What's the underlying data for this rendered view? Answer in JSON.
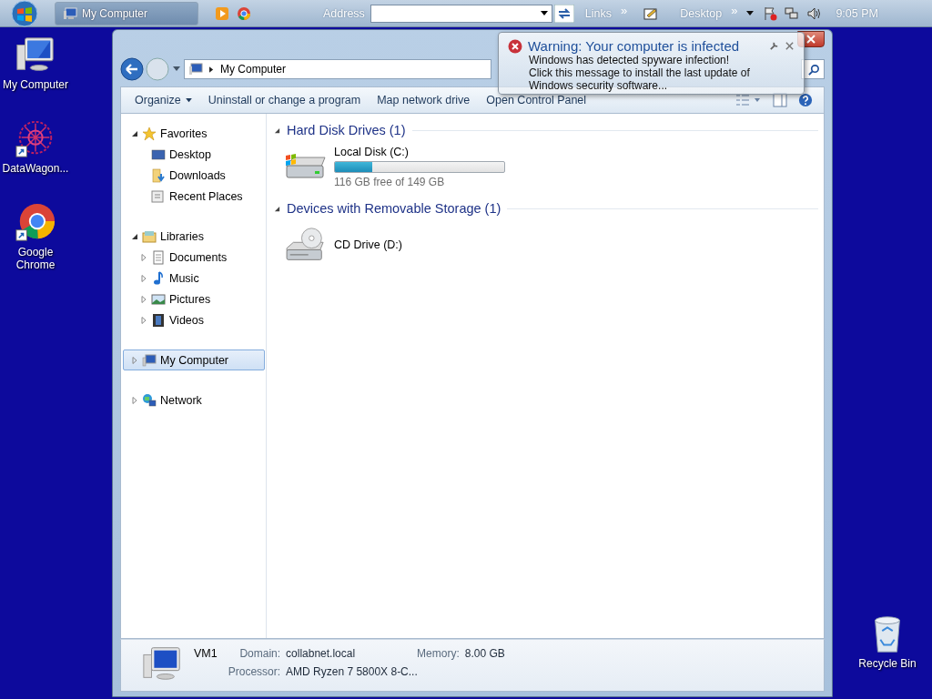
{
  "taskbar": {
    "task": {
      "label": "My Computer",
      "selected": true
    },
    "address_label": "Address",
    "links_label": "Links",
    "links_more": "»",
    "desktop_label": "Desktop",
    "desktop_more": "»",
    "clock": "9:05 PM"
  },
  "desktop_icons": [
    {
      "label": "My Computer",
      "kind": "computer"
    },
    {
      "label": "DataWagon...",
      "kind": "datawagon"
    },
    {
      "label": "Google Chrome",
      "kind": "chrome"
    }
  ],
  "recycle_bin": {
    "label": "Recycle Bin"
  },
  "window": {
    "breadcrumb": "My Computer",
    "toolbar": [
      {
        "label": "Organize",
        "kind": "menu"
      },
      {
        "label": "Uninstall or change a program",
        "kind": "command"
      },
      {
        "label": "Map network drive",
        "kind": "command"
      },
      {
        "label": "Open Control Panel",
        "kind": "command"
      }
    ],
    "nav": [
      {
        "label": "Favorites",
        "kind": "star",
        "expanded": true,
        "selected": false,
        "children": [
          {
            "label": "Desktop",
            "kind": "desktop",
            "selected": false
          },
          {
            "label": "Downloads",
            "kind": "downloads",
            "selected": false
          },
          {
            "label": "Recent Places",
            "kind": "recent",
            "selected": false
          }
        ]
      },
      {
        "label": "Libraries",
        "kind": "libraries",
        "expanded": true,
        "selected": false,
        "children": [
          {
            "label": "Documents",
            "kind": "documents",
            "expanded": false,
            "selected": false
          },
          {
            "label": "Music",
            "kind": "music",
            "expanded": false,
            "selected": false
          },
          {
            "label": "Pictures",
            "kind": "pictures",
            "expanded": false,
            "selected": false
          },
          {
            "label": "Videos",
            "kind": "videos",
            "expanded": false,
            "selected": false
          }
        ]
      },
      {
        "label": "My Computer",
        "kind": "computer",
        "expanded": false,
        "selected": true
      },
      {
        "label": "Network",
        "kind": "network",
        "expanded": false,
        "selected": false
      }
    ],
    "sections": [
      {
        "title": "Hard Disk Drives (1)",
        "expanded": true,
        "items": [
          {
            "name": "Local Disk (C:)",
            "kind": "hdd",
            "level": 0.22,
            "free": "116 GB free of 149 GB"
          }
        ]
      },
      {
        "title": "Devices with Removable Storage (1)",
        "expanded": true,
        "items": [
          {
            "name": "CD Drive (D:)",
            "kind": "cd"
          }
        ]
      }
    ],
    "details": {
      "name": "VM1",
      "fields": [
        {
          "label": "Domain:",
          "value": "collabnet.local"
        },
        {
          "label": "Memory:",
          "value": "8.00 GB"
        },
        {
          "label": "Processor:",
          "value": "AMD Ryzen 7 5800X 8-C..."
        }
      ]
    }
  },
  "balloon": {
    "title": "Warning: Your computer is infected",
    "lines": [
      "Windows has detected spyware infection!",
      "Click this message to install the last update of Windows security software..."
    ]
  }
}
